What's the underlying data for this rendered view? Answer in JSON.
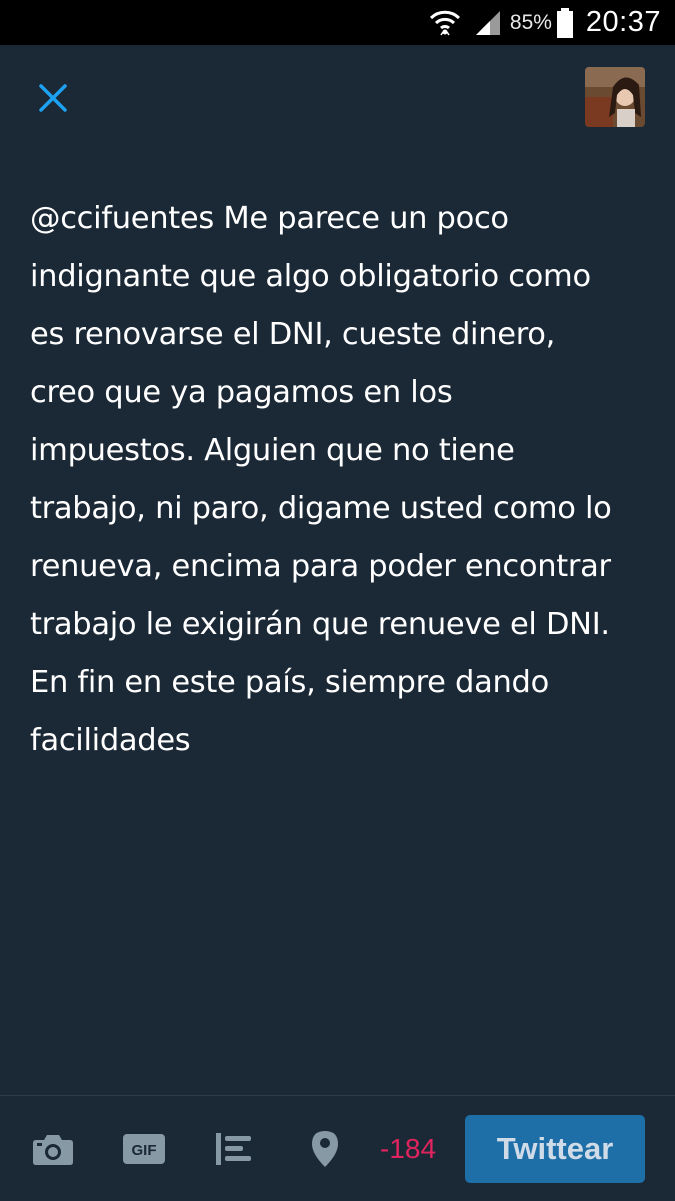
{
  "status_bar": {
    "battery": "85%",
    "time": "20:37",
    "icons": [
      "wifi-icon",
      "signal-icon",
      "battery-icon"
    ]
  },
  "header": {
    "close_icon": "close-icon",
    "avatar": "avatar"
  },
  "compose": {
    "text": "@ccifuentes Me parece un poco\nindignante que algo obligatorio como\nes renovarse el DNI, cueste dinero,\ncreo que ya pagamos en los\nimpuestos. Alguien que no tiene\ntrabajo, ni paro, digame usted como lo\nrenueva, encima para poder encontrar\ntrabajo le exigirán que renueve el DNI.\nEn fin en este país, siempre dando\nfacilidades"
  },
  "toolbar": {
    "icons": [
      "camera-icon",
      "gif-icon",
      "poll-icon",
      "location-icon"
    ],
    "gif_label": "GIF",
    "char_count": "-184",
    "tweet_button": "Twittear"
  },
  "colors": {
    "background": "#1b2836",
    "accent": "#1e6ea8",
    "close_icon": "#1da1f2",
    "counter_negative": "#e0245e",
    "icon_gray": "#8899a6"
  }
}
